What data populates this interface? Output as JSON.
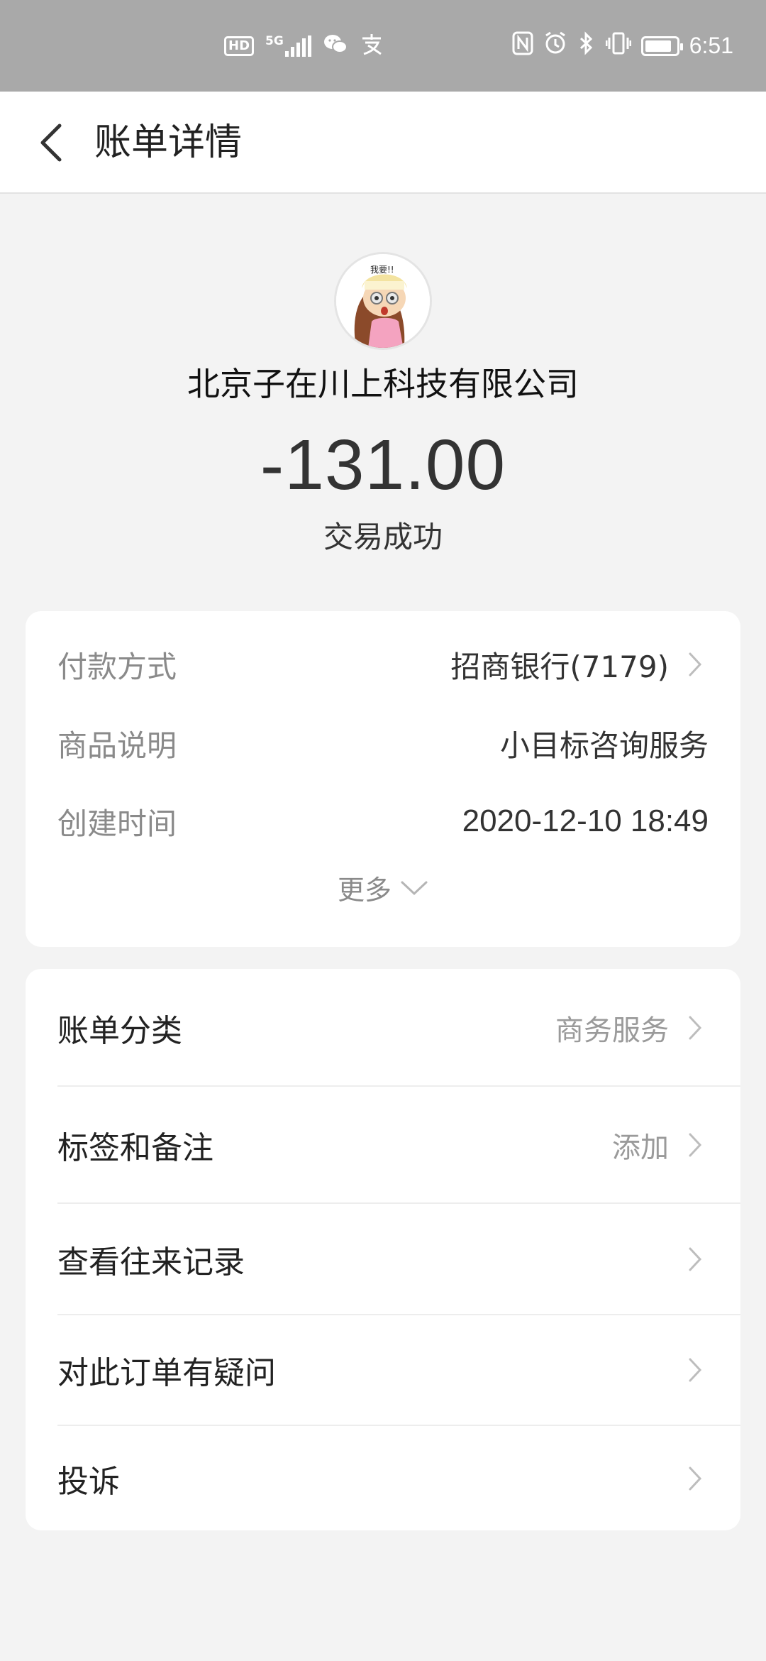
{
  "status_bar": {
    "hd": "HD",
    "network": "5G",
    "time": "6:51",
    "icons": [
      "hd-icon",
      "signal-icon",
      "wechat-icon",
      "alipay-icon",
      "nfc-icon",
      "alarm-icon",
      "bluetooth-icon",
      "vibrate-icon",
      "battery-icon"
    ]
  },
  "header": {
    "title": "账单详情"
  },
  "merchant": {
    "name": "北京子在川上科技有限公司",
    "amount": "-131.00",
    "status": "交易成功"
  },
  "info": {
    "rows": [
      {
        "label": "付款方式",
        "value": "招商银行(7179)"
      },
      {
        "label": "商品说明",
        "value": "小目标咨询服务"
      },
      {
        "label": "创建时间",
        "value": "2020-12-10 18:49"
      }
    ],
    "more": "更多"
  },
  "actions": [
    {
      "label": "账单分类",
      "value": "商务服务"
    },
    {
      "label": "标签和备注",
      "value": "添加"
    },
    {
      "label": "查看往来记录",
      "value": ""
    },
    {
      "label": "对此订单有疑问",
      "value": ""
    },
    {
      "label": "投诉",
      "value": ""
    }
  ],
  "colors": {
    "status_bar": "#a9a9a9",
    "background": "#f3f3f3",
    "card": "#ffffff",
    "muted_text": "#8a8a8a"
  }
}
